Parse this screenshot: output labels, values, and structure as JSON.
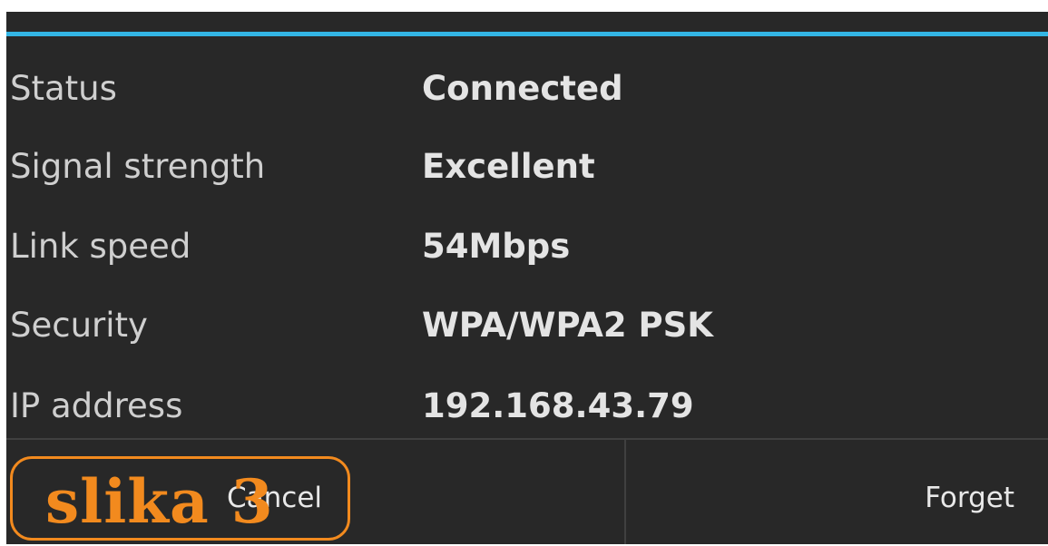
{
  "dialog": {
    "accent_color": "#33b5e5",
    "rows": [
      {
        "label": "Status",
        "value": "Connected"
      },
      {
        "label": "Signal strength",
        "value": "Excellent"
      },
      {
        "label": "Link speed",
        "value": "54Mbps"
      },
      {
        "label": "Security",
        "value": "WPA/WPA2 PSK"
      },
      {
        "label": "IP address",
        "value": "192.168.43.79"
      }
    ],
    "buttons": {
      "cancel_label": "Cancel",
      "forget_label": "Forget"
    }
  },
  "watermark": {
    "text": "slika 3",
    "color": "#f28a1e"
  }
}
